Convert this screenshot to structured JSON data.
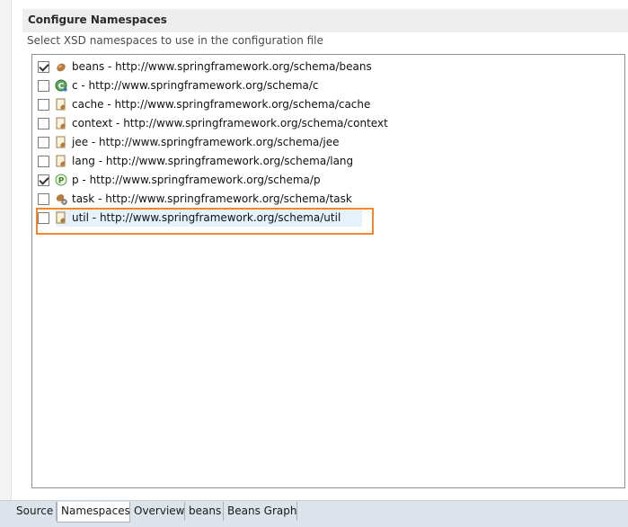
{
  "section": {
    "title": "Configure Namespaces",
    "description": "Select XSD namespaces to use in the configuration file"
  },
  "namespaces": [
    {
      "label": "beans - http://www.springframework.org/schema/beans",
      "checked": true,
      "icon": "bean-icon"
    },
    {
      "label": "c - http://www.springframework.org/schema/c",
      "checked": false,
      "icon": "c-namespace-icon"
    },
    {
      "label": "cache - http://www.springframework.org/schema/cache",
      "checked": false,
      "icon": "schema-file-icon"
    },
    {
      "label": "context - http://www.springframework.org/schema/context",
      "checked": false,
      "icon": "schema-file-icon"
    },
    {
      "label": "jee - http://www.springframework.org/schema/jee",
      "checked": false,
      "icon": "schema-file-icon"
    },
    {
      "label": "lang - http://www.springframework.org/schema/lang",
      "checked": false,
      "icon": "schema-file-icon"
    },
    {
      "label": "p - http://www.springframework.org/schema/p",
      "checked": true,
      "icon": "p-namespace-icon"
    },
    {
      "label": "task - http://www.springframework.org/schema/task",
      "checked": false,
      "icon": "task-icon"
    },
    {
      "label": "util - http://www.springframework.org/schema/util",
      "checked": false,
      "icon": "schema-file-icon",
      "selected": true
    }
  ],
  "tabs": [
    {
      "label": "Source",
      "active": false
    },
    {
      "label": "Namespaces",
      "active": true
    },
    {
      "label": "Overview",
      "active": false
    },
    {
      "label": "beans",
      "active": false
    },
    {
      "label": "Beans Graph",
      "active": false
    }
  ],
  "colors": {
    "highlight_border": "#f0862e",
    "selection_bg": "#e5f1fb",
    "tabbar_bg": "#dde3ea"
  }
}
